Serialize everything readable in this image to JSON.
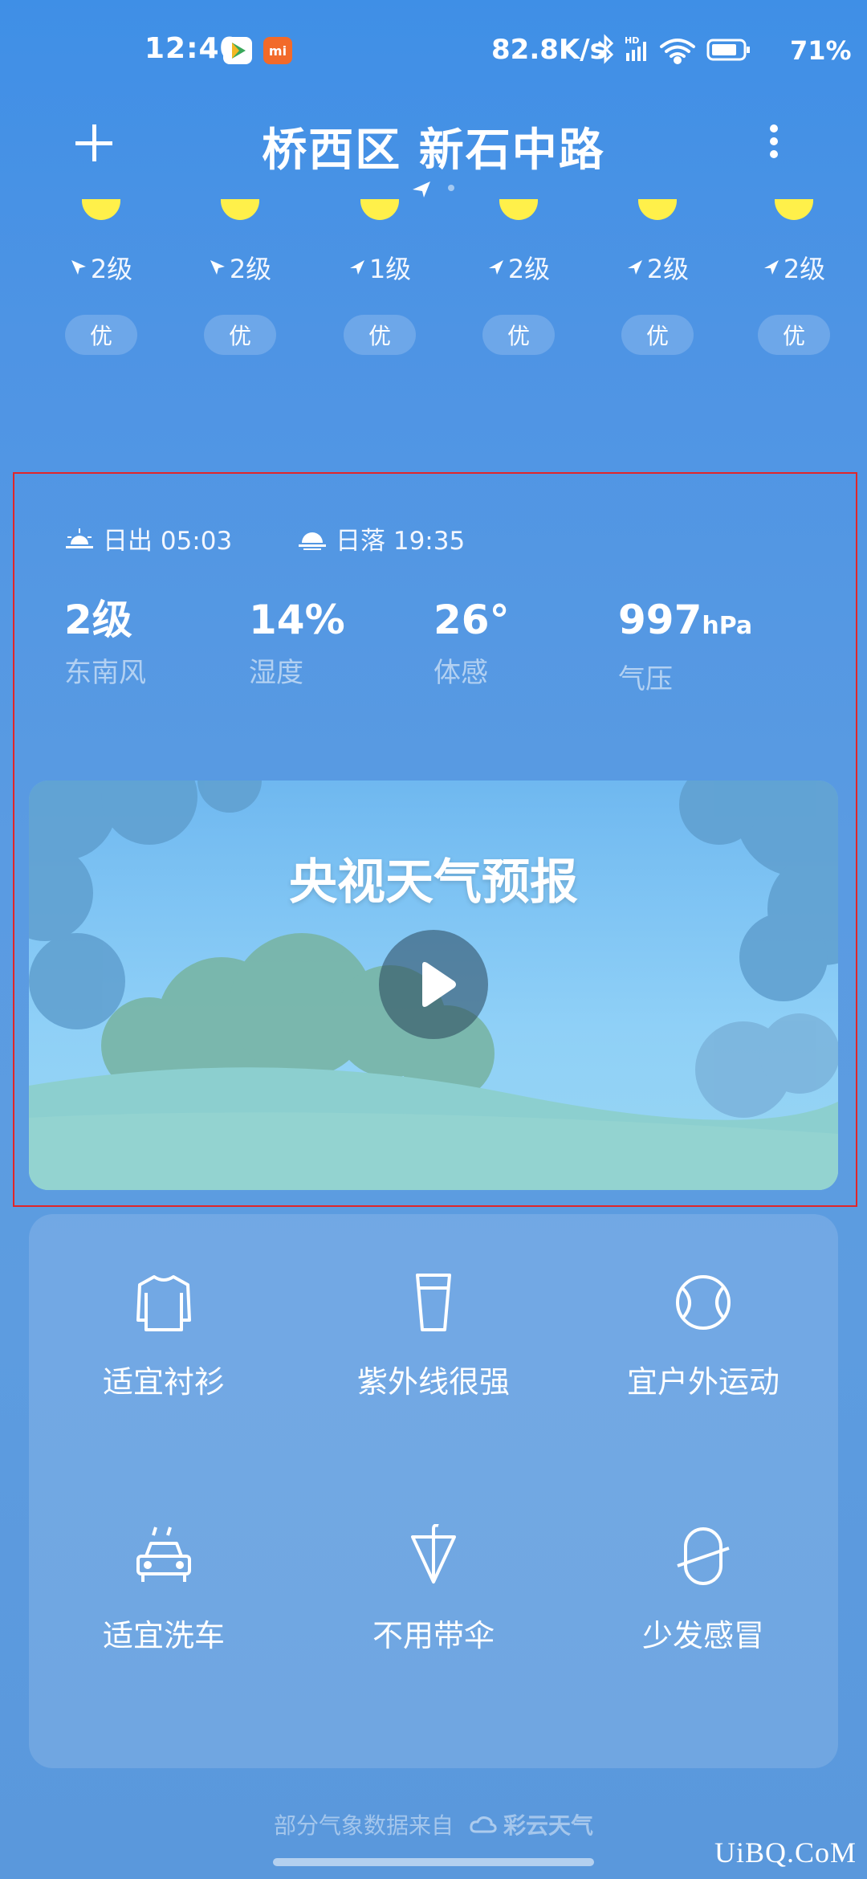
{
  "status_bar": {
    "time": "12:40",
    "mi_badge": "mi",
    "network_speed": "82.8K/s",
    "battery": "71%"
  },
  "header": {
    "location": "桥西区 新石中路"
  },
  "hourly": [
    {
      "wind": "2级",
      "aqi": "优"
    },
    {
      "wind": "2级",
      "aqi": "优"
    },
    {
      "wind": "1级",
      "aqi": "优"
    },
    {
      "wind": "2级",
      "aqi": "优"
    },
    {
      "wind": "2级",
      "aqi": "优"
    },
    {
      "wind": "2级",
      "aqi": "优"
    }
  ],
  "sun": {
    "sunrise": "日出 05:03",
    "sunset": "日落 19:35"
  },
  "stats": [
    {
      "value": "2级",
      "label": "东南风"
    },
    {
      "value": "14%",
      "label": "湿度"
    },
    {
      "value": "26°",
      "label": "体感"
    },
    {
      "value": "997",
      "unit": "hPa",
      "label": "气压"
    }
  ],
  "video": {
    "title": "央视天气预报"
  },
  "tips": [
    {
      "label": "适宜衬衫",
      "icon": "shirt-icon"
    },
    {
      "label": "紫外线很强",
      "icon": "sunscreen-icon"
    },
    {
      "label": "宜户外运动",
      "icon": "ball-icon"
    },
    {
      "label": "适宜洗车",
      "icon": "car-wash-icon"
    },
    {
      "label": "不用带伞",
      "icon": "umbrella-icon"
    },
    {
      "label": "少发感冒",
      "icon": "capsule-icon"
    }
  ],
  "footer": {
    "source_text": "部分气象数据来自",
    "brand": "彩云天气",
    "watermark": "UiBQ.CoM"
  },
  "colors": {
    "background_top": "#3f8fe6",
    "sun_yellow": "#fff04a",
    "highlight_border": "#e0262a"
  }
}
